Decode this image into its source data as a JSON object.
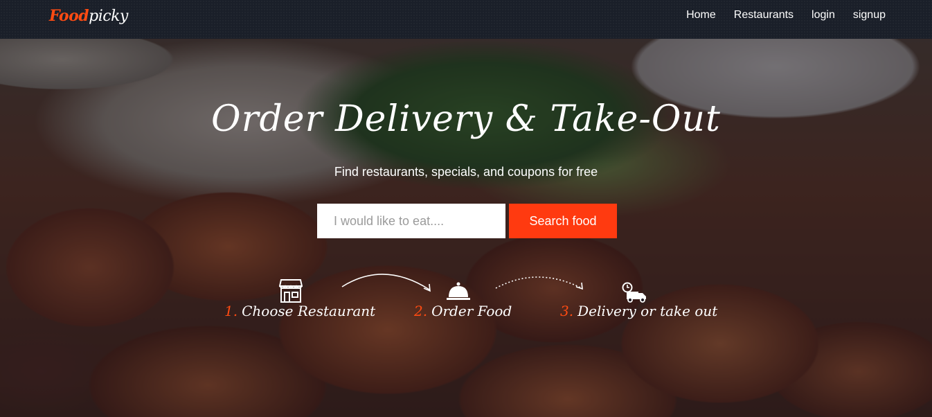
{
  "logo": {
    "part1": "Food",
    "part2": "picky"
  },
  "nav": {
    "items": [
      {
        "label": "Home"
      },
      {
        "label": "Restaurants"
      },
      {
        "label": "login"
      },
      {
        "label": "signup"
      }
    ]
  },
  "hero": {
    "headline": "Order Delivery & Take-Out",
    "subtitle": "Find restaurants, specials, and coupons for free",
    "search": {
      "placeholder": "I would like to eat....",
      "value": "",
      "button_label": "Search food"
    },
    "steps": [
      {
        "number": "1.",
        "label": "Choose Restaurant",
        "icon": "store-icon"
      },
      {
        "number": "2.",
        "label": "Order Food",
        "icon": "cloche-icon"
      },
      {
        "number": "3.",
        "label": "Delivery or take out",
        "icon": "delivery-truck-icon"
      }
    ]
  },
  "colors": {
    "accent": "#ff3a10",
    "navbar": "#1a1f29",
    "text": "#ffffff"
  }
}
